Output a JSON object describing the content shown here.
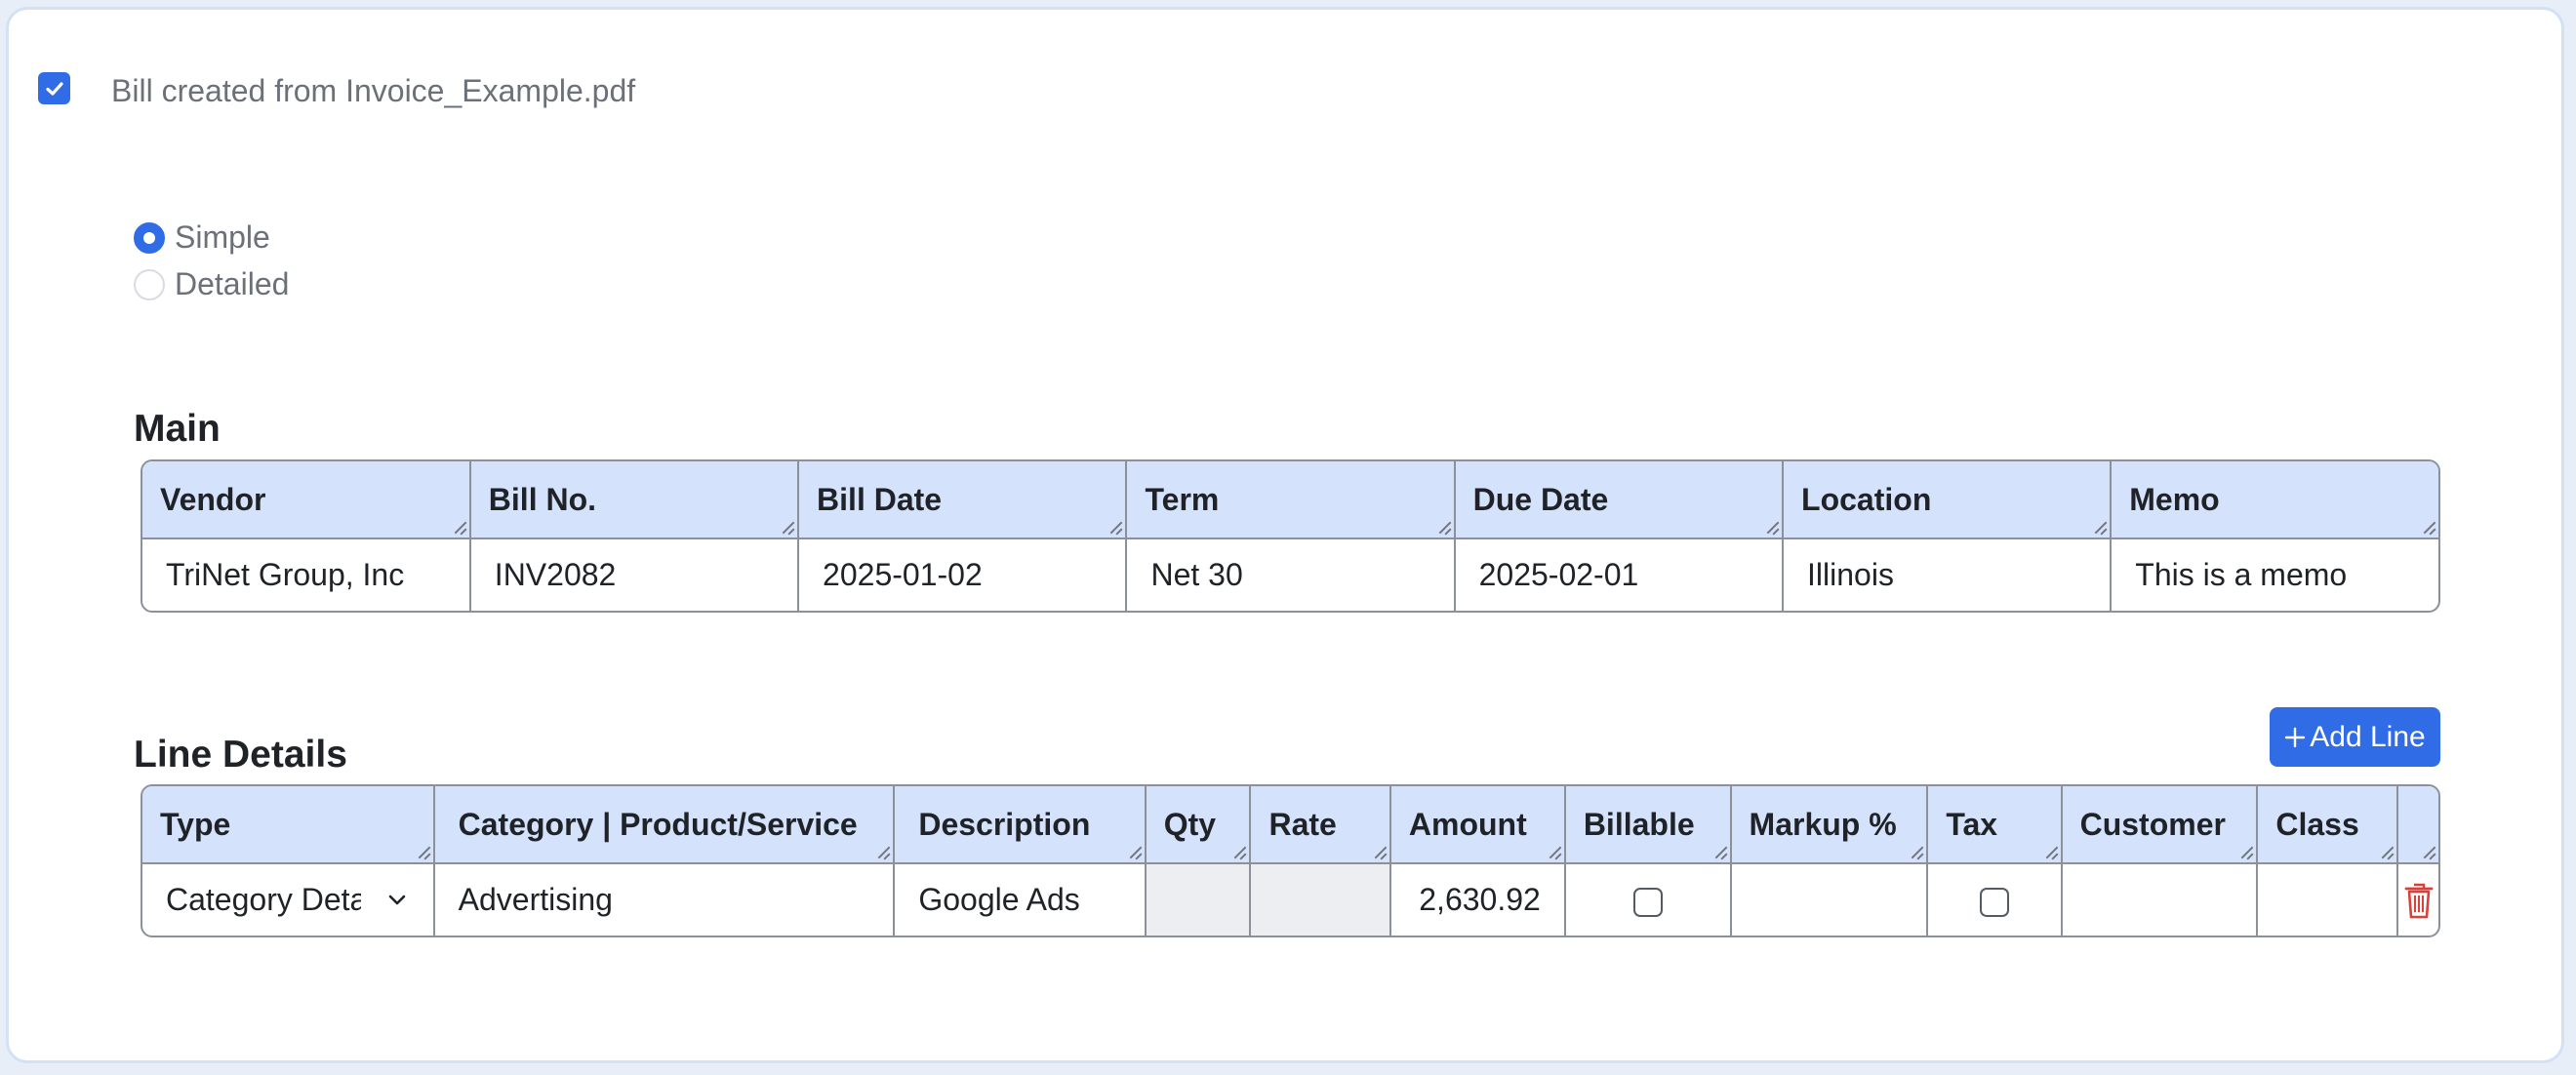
{
  "bill_notice": "Bill created from Invoice_Example.pdf",
  "view_mode": {
    "options": [
      {
        "label": "Simple",
        "selected": true
      },
      {
        "label": "Detailed",
        "selected": false
      }
    ]
  },
  "main": {
    "title": "Main",
    "headers": [
      "Vendor",
      "Bill No.",
      "Bill Date",
      "Term",
      "Due Date",
      "Location",
      "Memo"
    ],
    "row": [
      "TriNet Group, Inc",
      "INV2082",
      "2025-01-02",
      "Net 30",
      "2025-02-01",
      "Illinois",
      "This is a memo"
    ]
  },
  "line_details": {
    "title": "Line Details",
    "add_line_label": "Add Line",
    "headers": [
      "Type",
      "Category | Product/Service",
      "Description",
      "Qty",
      "Rate",
      "Amount",
      "Billable",
      "Markup %",
      "Tax",
      "Customer",
      "Class",
      ""
    ],
    "row": {
      "type": "Category Details",
      "category": "Advertising",
      "description": "Google Ads",
      "qty": "",
      "rate": "",
      "amount": "2,630.92",
      "billable": false,
      "markup": "",
      "tax": false,
      "customer": "",
      "class": ""
    }
  },
  "colors": {
    "accent": "#2f6ce5",
    "header_bg": "#d5e2fb",
    "delete": "#d9403a"
  },
  "icons": {
    "check": "check-icon",
    "chevron": "chevron-down-icon",
    "plus": "plus-icon",
    "trash": "trash-icon"
  }
}
